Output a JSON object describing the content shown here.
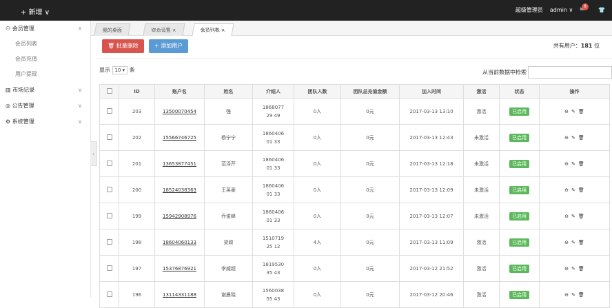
{
  "topbar": {
    "add_label": "+ 新增 ∨",
    "user_role": "超级管理员",
    "username": "admin ∨",
    "msg_count": "8",
    "shirt_icon": "tshirt-icon"
  },
  "sidebar": {
    "groups": [
      {
        "label": "会员管理",
        "items": [
          "会员列表",
          "会员充值",
          "用户提现"
        ]
      },
      {
        "label": "市场记录",
        "items": []
      },
      {
        "label": "公告管理",
        "items": []
      },
      {
        "label": "系统管理",
        "items": []
      }
    ]
  },
  "tabs": [
    {
      "label": "我的桌面"
    },
    {
      "label": "综合设置",
      "close": "×"
    },
    {
      "label": "会员列表",
      "close": "×"
    }
  ],
  "toolbar": {
    "batch_delete": "批量删除",
    "add_user": "添加用户",
    "total_prefix": "共有用户：",
    "total_count": "181",
    "total_suffix": "位"
  },
  "table_controls": {
    "show_prefix": "显示",
    "page_size": "10 ▾",
    "show_suffix": "条",
    "search_label": "从当前数据中检索"
  },
  "columns": [
    "",
    "ID",
    "账户名",
    "姓名",
    "介绍人",
    "团队人数",
    "团队总充值金额",
    "加入时间",
    "激活",
    "状态",
    "操作"
  ],
  "rows": [
    {
      "id": "203",
      "account": "13500070454",
      "name": "强",
      "ref": "186807729 49",
      "team": "0人",
      "amount": "0元",
      "time": "2017-03-13 13:10",
      "active": "激活",
      "status": "已启用"
    },
    {
      "id": "202",
      "account": "15566746725",
      "name": "杨宁宁",
      "ref": "186040601 33",
      "team": "0人",
      "amount": "0元",
      "time": "2017-03-13 12:43",
      "active": "未激活",
      "status": "已启用"
    },
    {
      "id": "201",
      "account": "13653877451",
      "name": "范泽芹",
      "ref": "186040601 33",
      "team": "0人",
      "amount": "0元",
      "time": "2017-03-13 12:18",
      "active": "未激活",
      "status": "已启用"
    },
    {
      "id": "200",
      "account": "18524038363",
      "name": "王英豪",
      "ref": "186040601 33",
      "team": "0人",
      "amount": "0元",
      "time": "2017-03-13 12:09",
      "active": "未激活",
      "status": "已启用"
    },
    {
      "id": "199",
      "account": "15942908976",
      "name": "乔俊峰",
      "ref": "186040601 33",
      "team": "0人",
      "amount": "0元",
      "time": "2017-03-13 12:07",
      "active": "未激活",
      "status": "已启用"
    },
    {
      "id": "198",
      "account": "18604060133",
      "name": "梁颖",
      "ref": "151071925 12",
      "team": "4人",
      "amount": "0元",
      "time": "2017-03-13 11:09",
      "active": "激活",
      "status": "已启用"
    },
    {
      "id": "197",
      "account": "15376876921",
      "name": "李威超",
      "ref": "181953035 43",
      "team": "0人",
      "amount": "0元",
      "time": "2017-03-12 21:52",
      "active": "激活",
      "status": "已启用"
    },
    {
      "id": "196",
      "account": "13114331188",
      "name": "谢晨晓",
      "ref": "156003855 43",
      "team": "0人",
      "amount": "0元",
      "time": "2017-03-12 20:46",
      "active": "激活",
      "status": "已启用"
    }
  ],
  "ops": {
    "disable": "⊖",
    "edit": "✎",
    "delete": "🗑"
  }
}
